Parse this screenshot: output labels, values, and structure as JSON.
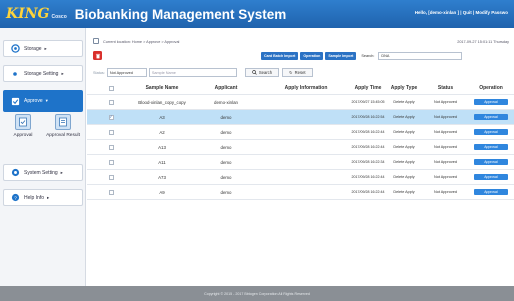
{
  "header": {
    "logo_text": "KING",
    "logo_sub": "Cosco",
    "title": "Biobanking Management System",
    "user_links": "Hello, [demo-xinlan ] | Quit | Modify Passwo"
  },
  "sidebar": {
    "items": [
      {
        "label": "Storage",
        "icon": "storage-icon"
      },
      {
        "label": "Storage Setting",
        "icon": "storage-setting-icon"
      },
      {
        "label": "Approve",
        "icon": "approve-icon"
      },
      {
        "label": "System Setting",
        "icon": "system-setting-icon"
      },
      {
        "label": "Help Info",
        "icon": "help-icon"
      }
    ],
    "sub_items": [
      {
        "label": "Approval",
        "icon": "approval-icon"
      },
      {
        "label": "Approval Result",
        "icon": "approval-result-icon"
      }
    ]
  },
  "main": {
    "breadcrumb": "Current location: Home > Approve > Approval",
    "date": "2017-09-27  15:01:11  Thursday",
    "buttons": {
      "card_batch_import": "Card Batch Import",
      "operation": "Operation",
      "sample_import": "Sample Import"
    },
    "search_label": "Search:",
    "search_value": "DNA",
    "filter": {
      "status_label": "Status:",
      "status_value": "Not Approved",
      "name_placeholder": "Sample Name",
      "search_btn": "Search",
      "reset_btn": "Reset"
    },
    "table": {
      "headers": [
        "Sample Name",
        "Applicant",
        "Apply Information",
        "Apply Time",
        "Apply Type",
        "Status",
        "Operation"
      ],
      "rows": [
        {
          "name": "Blood-xinlan_copy_copy",
          "applicant": "demo-xinlan",
          "info": "",
          "time": "2017/09/27 15:45:05",
          "type": "Delete Apply",
          "status": "Not Approved",
          "op": "Approval",
          "selected": false
        },
        {
          "name": "A3",
          "applicant": "demo",
          "info": "",
          "time": "2017/09/28 16:22:54",
          "type": "Delete Apply",
          "status": "Not Approved",
          "op": "Approval",
          "selected": true
        },
        {
          "name": "A2",
          "applicant": "demo",
          "info": "",
          "time": "2017/09/28 16:22:44",
          "type": "Delete Apply",
          "status": "Not Approved",
          "op": "Approval",
          "selected": false
        },
        {
          "name": "A13",
          "applicant": "demo",
          "info": "",
          "time": "2017/09/28 16:22:44",
          "type": "Delete Apply",
          "status": "Not Approved",
          "op": "Approval",
          "selected": false
        },
        {
          "name": "A11",
          "applicant": "demo",
          "info": "",
          "time": "2017/09/28 16:22:34",
          "type": "Delete Apply",
          "status": "Not Approved",
          "op": "Approval",
          "selected": false
        },
        {
          "name": "A73",
          "applicant": "demo",
          "info": "",
          "time": "2017/09/28 16:22:44",
          "type": "Delete Apply",
          "status": "Not Approved",
          "op": "Approval",
          "selected": false
        },
        {
          "name": "A9",
          "applicant": "demo",
          "info": "",
          "time": "2017/09/28 16:22:44",
          "type": "Delete Apply",
          "status": "Not Approved",
          "op": "Approval",
          "selected": false
        }
      ]
    }
  },
  "footer": {
    "text": "Copyright © 2015 - 2017  Bbtogen Corporation All Rights Reserved"
  },
  "colors": {
    "header_blue": "#2f7fce",
    "active_blue": "#1e73c9",
    "selected_row": "#bfe0f7",
    "delete_red": "#d9302c",
    "logo_yellow": "#ffd43b"
  }
}
